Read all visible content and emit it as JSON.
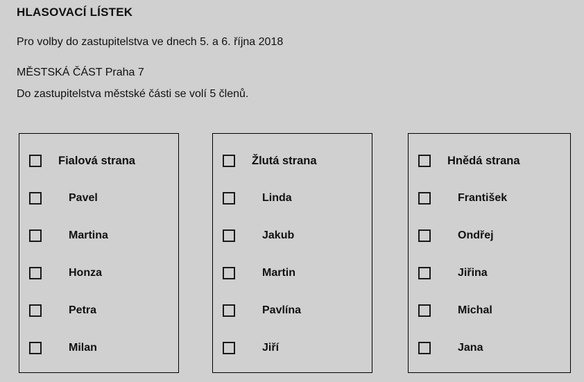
{
  "document": {
    "title": "HLASOVACÍ LÍSTEK",
    "election_line": "Pro volby do zastupitelstva ve dnech 5. a 6. října 2018",
    "district_line": "MĚSTSKÁ ČÁST Praha 7",
    "seats_line": "Do zastupitelstva městské části se volí 5 členů.",
    "background_color": "#d0d0d0",
    "border_color": "#000000",
    "text_color": "#111111"
  },
  "parties": [
    {
      "name": "Fialová strana",
      "checkbox_checked": false,
      "candidates": [
        {
          "name": "Pavel",
          "checkbox_checked": false
        },
        {
          "name": "Martina",
          "checkbox_checked": false
        },
        {
          "name": "Honza",
          "checkbox_checked": false
        },
        {
          "name": "Petra",
          "checkbox_checked": false
        },
        {
          "name": "Milan",
          "checkbox_checked": false
        }
      ]
    },
    {
      "name": "Žlutá strana",
      "checkbox_checked": false,
      "candidates": [
        {
          "name": "Linda",
          "checkbox_checked": false
        },
        {
          "name": "Jakub",
          "checkbox_checked": false
        },
        {
          "name": "Martin",
          "checkbox_checked": false
        },
        {
          "name": "Pavlína",
          "checkbox_checked": false
        },
        {
          "name": "Jiří",
          "checkbox_checked": false
        }
      ]
    },
    {
      "name": "Hnědá strana",
      "checkbox_checked": false,
      "candidates": [
        {
          "name": "František",
          "checkbox_checked": false
        },
        {
          "name": "Ondřej",
          "checkbox_checked": false
        },
        {
          "name": "Jiřina",
          "checkbox_checked": false
        },
        {
          "name": "Michal",
          "checkbox_checked": false
        },
        {
          "name": "Jana",
          "checkbox_checked": false
        }
      ]
    }
  ]
}
